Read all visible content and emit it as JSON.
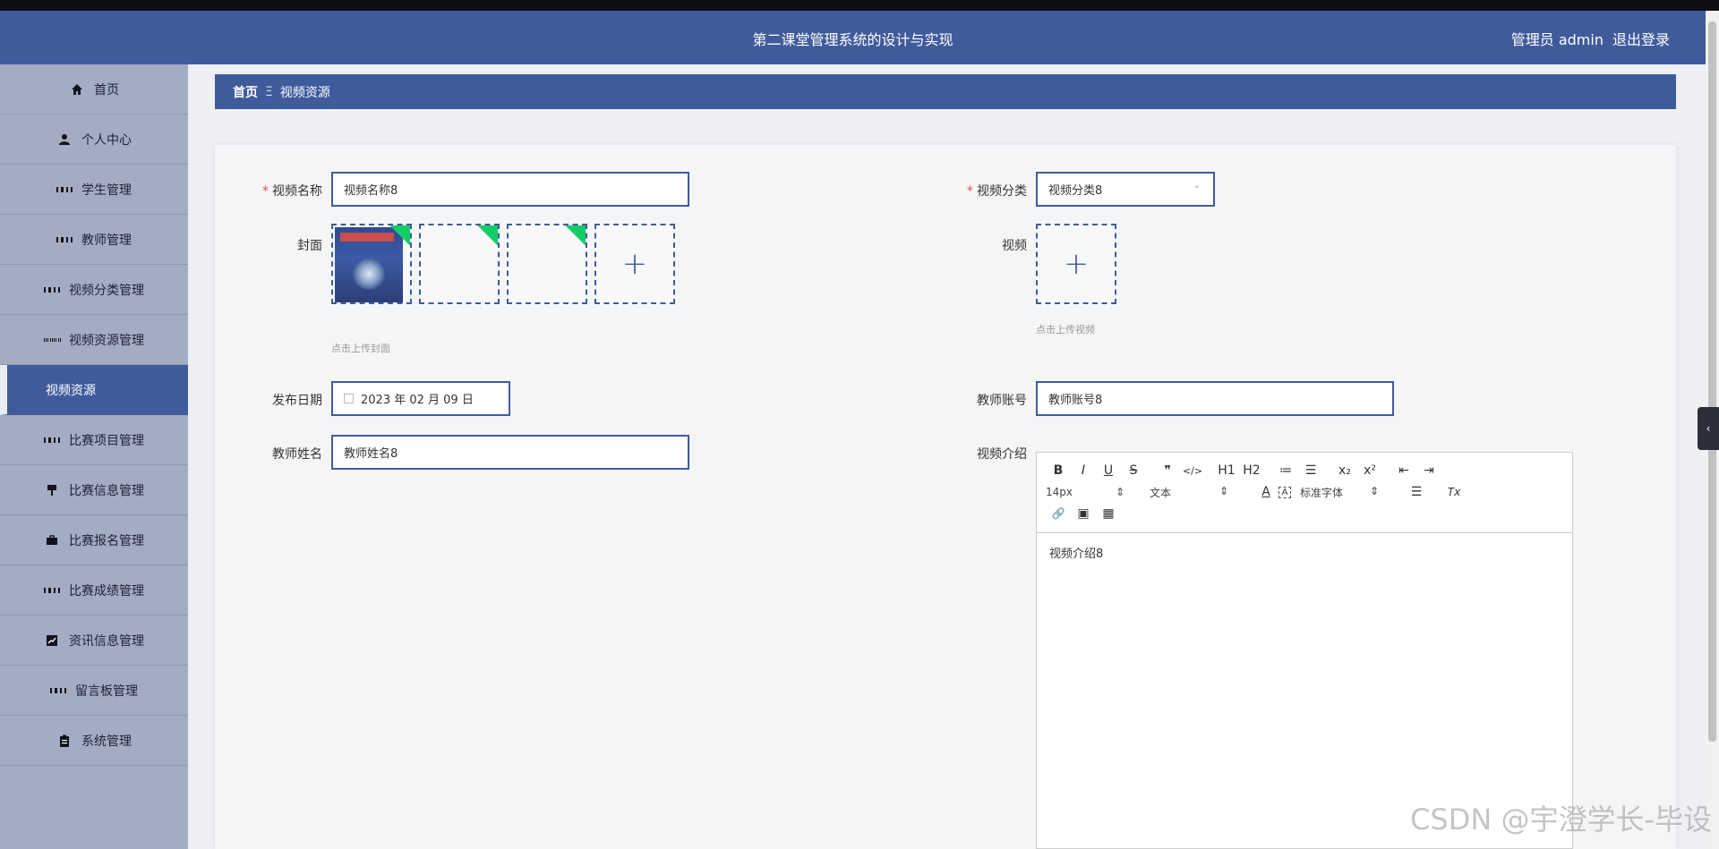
{
  "header": {
    "title": "第二课堂管理系统的设计与实现",
    "role": "管理员 admin",
    "logout": "退出登录"
  },
  "sidebar": {
    "items": [
      {
        "label": "首页",
        "icon": "home-icon"
      },
      {
        "label": "个人中心",
        "icon": "user-icon"
      },
      {
        "label": "学生管理",
        "icon": "grid-icon"
      },
      {
        "label": "教师管理",
        "icon": "grid-icon"
      },
      {
        "label": "视频分类管理",
        "icon": "grid-icon"
      },
      {
        "label": "视频资源管理",
        "icon": "grid9-icon"
      },
      {
        "label": "视频资源",
        "icon": ""
      },
      {
        "label": "比赛项目管理",
        "icon": "grid-icon"
      },
      {
        "label": "比赛信息管理",
        "icon": "brush-icon"
      },
      {
        "label": "比赛报名管理",
        "icon": "briefcase-icon"
      },
      {
        "label": "比赛成绩管理",
        "icon": "grid-icon"
      },
      {
        "label": "资讯信息管理",
        "icon": "chart-icon"
      },
      {
        "label": "留言板管理",
        "icon": "grid-icon"
      },
      {
        "label": "系统管理",
        "icon": "clipboard-icon"
      }
    ]
  },
  "breadcrumb": {
    "home": "首页",
    "separator": "Ξ",
    "current": "视频资源"
  },
  "form": {
    "video_name_label": "视频名称",
    "video_name_value": "视频名称8",
    "category_label": "视频分类",
    "category_value": "视频分类8",
    "cover_label": "封面",
    "cover_hint": "点击上传封面",
    "video_label": "视频",
    "video_hint": "点击上传视频",
    "date_label": "发布日期",
    "date_value": "2023 年 02 月 09 日",
    "teacher_account_label": "教师账号",
    "teacher_account_value": "教师账号8",
    "teacher_name_label": "教师姓名",
    "teacher_name_value": "教师姓名8",
    "intro_label": "视频介绍",
    "intro_value": "视频介绍8",
    "required_mark": "*",
    "plus": "+"
  },
  "editor": {
    "row1": [
      "B",
      "I",
      "U",
      "S",
      "❞",
      "</>",
      "H1",
      "H2",
      "≔",
      "☰",
      "x₂",
      "x²",
      "⇤",
      "⇥"
    ],
    "font_size": "14px",
    "paragraph": "文本",
    "font_family": "标准字体",
    "color_btn": "A",
    "bg_btn": "A",
    "align_btn": "☰",
    "clear_btn": "Tx",
    "select_arrow": "⇕",
    "row3": [
      "🔗",
      "▣",
      "▦"
    ]
  },
  "misc": {
    "side_tab": "‹",
    "watermark": "CSDN @宇澄学长-毕设"
  },
  "colors": {
    "primary": "#3f5b9c",
    "sidebar_bg": "#a4acc3",
    "success_flag": "#13ce66",
    "required": "#e24a4a"
  }
}
